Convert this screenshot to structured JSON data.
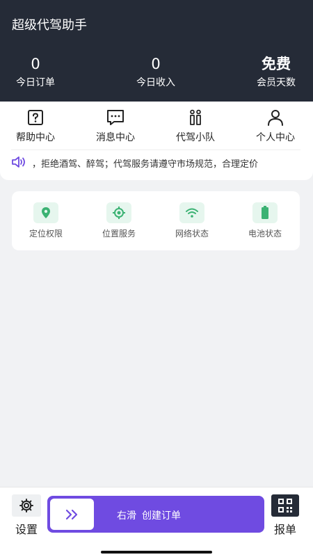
{
  "header": {
    "title": "超级代驾助手",
    "stats": [
      {
        "value": "0",
        "label": "今日订单"
      },
      {
        "value": "0",
        "label": "今日收入"
      },
      {
        "value": "免费",
        "label": "会员天数"
      }
    ]
  },
  "menu": {
    "items": [
      {
        "label": "帮助中心",
        "icon": "help-icon"
      },
      {
        "label": "消息中心",
        "icon": "message-icon"
      },
      {
        "label": "代驾小队",
        "icon": "team-icon"
      },
      {
        "label": "个人中心",
        "icon": "user-icon"
      }
    ]
  },
  "notice": {
    "text": "，拒绝酒驾、醉驾；代驾服务请遵守市场规范，合理定价"
  },
  "status": {
    "items": [
      {
        "label": "定位权限",
        "icon": "location-pin-icon"
      },
      {
        "label": "位置服务",
        "icon": "location-target-icon"
      },
      {
        "label": "网络状态",
        "icon": "wifi-icon"
      },
      {
        "label": "电池状态",
        "icon": "battery-icon"
      }
    ]
  },
  "bottom": {
    "settings_label": "设置",
    "slider_hint": "右滑",
    "slider_action": "创建订单",
    "report_label": "报单"
  },
  "colors": {
    "header_bg": "#252b37",
    "accent_purple": "#6f4be1",
    "status_green": "#3bb273",
    "status_bg": "#e6f6ee"
  }
}
